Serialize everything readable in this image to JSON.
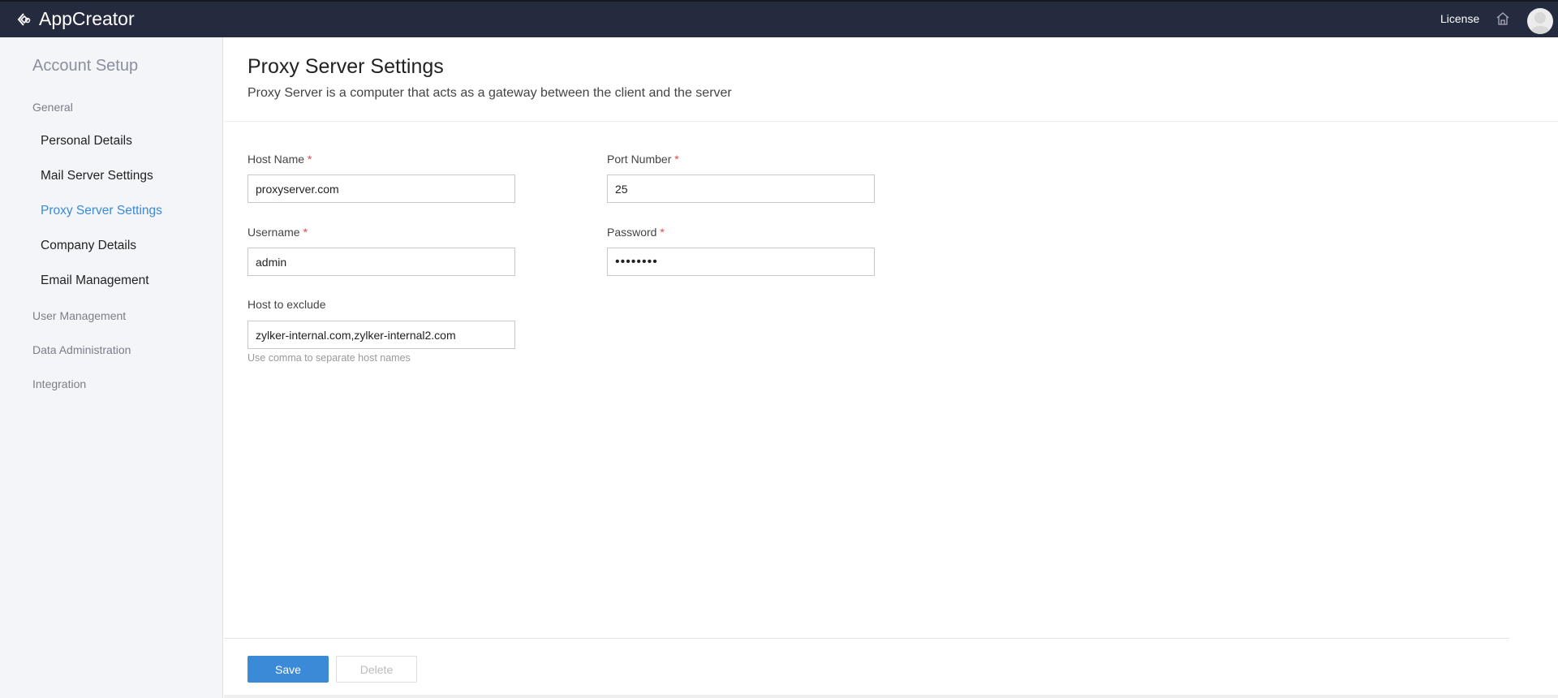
{
  "header": {
    "app_name": "AppCreator",
    "license_label": "License"
  },
  "sidebar": {
    "title": "Account Setup",
    "sections": [
      {
        "label": "General",
        "items": [
          {
            "label": "Personal Details"
          },
          {
            "label": "Mail Server Settings"
          },
          {
            "label": "Proxy Server Settings",
            "active": true
          },
          {
            "label": "Company Details"
          },
          {
            "label": "Email Management"
          }
        ]
      },
      {
        "label": "User Management"
      },
      {
        "label": "Data Administration"
      },
      {
        "label": "Integration"
      }
    ]
  },
  "main": {
    "title": "Proxy Server Settings",
    "subtitle": "Proxy Server is a computer that acts as a gateway between the client and the server",
    "fields": {
      "host_name": {
        "label": "Host Name",
        "value": "proxyserver.com",
        "required": "*"
      },
      "port_number": {
        "label": "Port Number",
        "value": "25",
        "required": "*"
      },
      "username": {
        "label": "Username",
        "value": "admin",
        "required": "*"
      },
      "password": {
        "label": "Password",
        "value": "password",
        "required": "*"
      },
      "host_exclude": {
        "label": "Host to exclude",
        "value": "zylker-internal.com,zylker-internal2.com",
        "hint": "Use comma to separate host names"
      }
    },
    "save_label": "Save",
    "delete_label": "Delete"
  },
  "colors": {
    "accent": "#3a8ad8",
    "header_bg": "#252b3e",
    "sidebar_bg": "#f4f5f9"
  }
}
